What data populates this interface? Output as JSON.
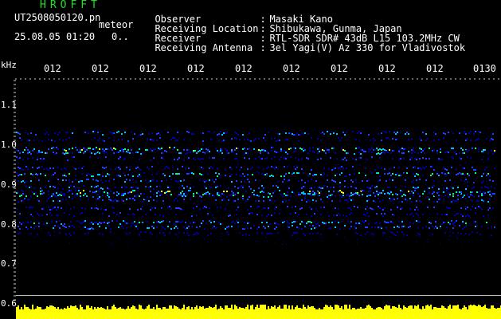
{
  "header": {
    "logo": "HROFFT",
    "filename": "UT2508050120.pn",
    "mode": "meteor",
    "datetime": "25.08.05 01:20",
    "extra": "0.."
  },
  "meta": [
    {
      "label": "Observer",
      "sep": ":",
      "value": "Masaki Kano"
    },
    {
      "label": "Receiving Location",
      "sep": ":",
      "value": "Shibukawa, Gunma, Japan"
    },
    {
      "label": "Receiver",
      "sep": ":",
      "value": "RTL-SDR SDR# 43dB L15 103.2MHz CW"
    },
    {
      "label": "Receiving Antenna",
      "sep": ":",
      "value": "3el Yagi(V) Az 330 for Vladivostok"
    }
  ],
  "axis": {
    "unit": "kHz",
    "yticks": [
      "1.1",
      "1.0",
      "0.9",
      "0.8",
      "0.7",
      "0.6"
    ],
    "xticks": [
      "012",
      "012",
      "012",
      "012",
      "012",
      "012",
      "012",
      "012",
      "012",
      "0130"
    ]
  },
  "colors": {
    "background": "#000000",
    "logo": "#20e020",
    "signal_low": "#0000a0",
    "signal_mid": "#00c0ff",
    "signal_high": "#ffff00",
    "level_bar": "#ffff00"
  }
}
